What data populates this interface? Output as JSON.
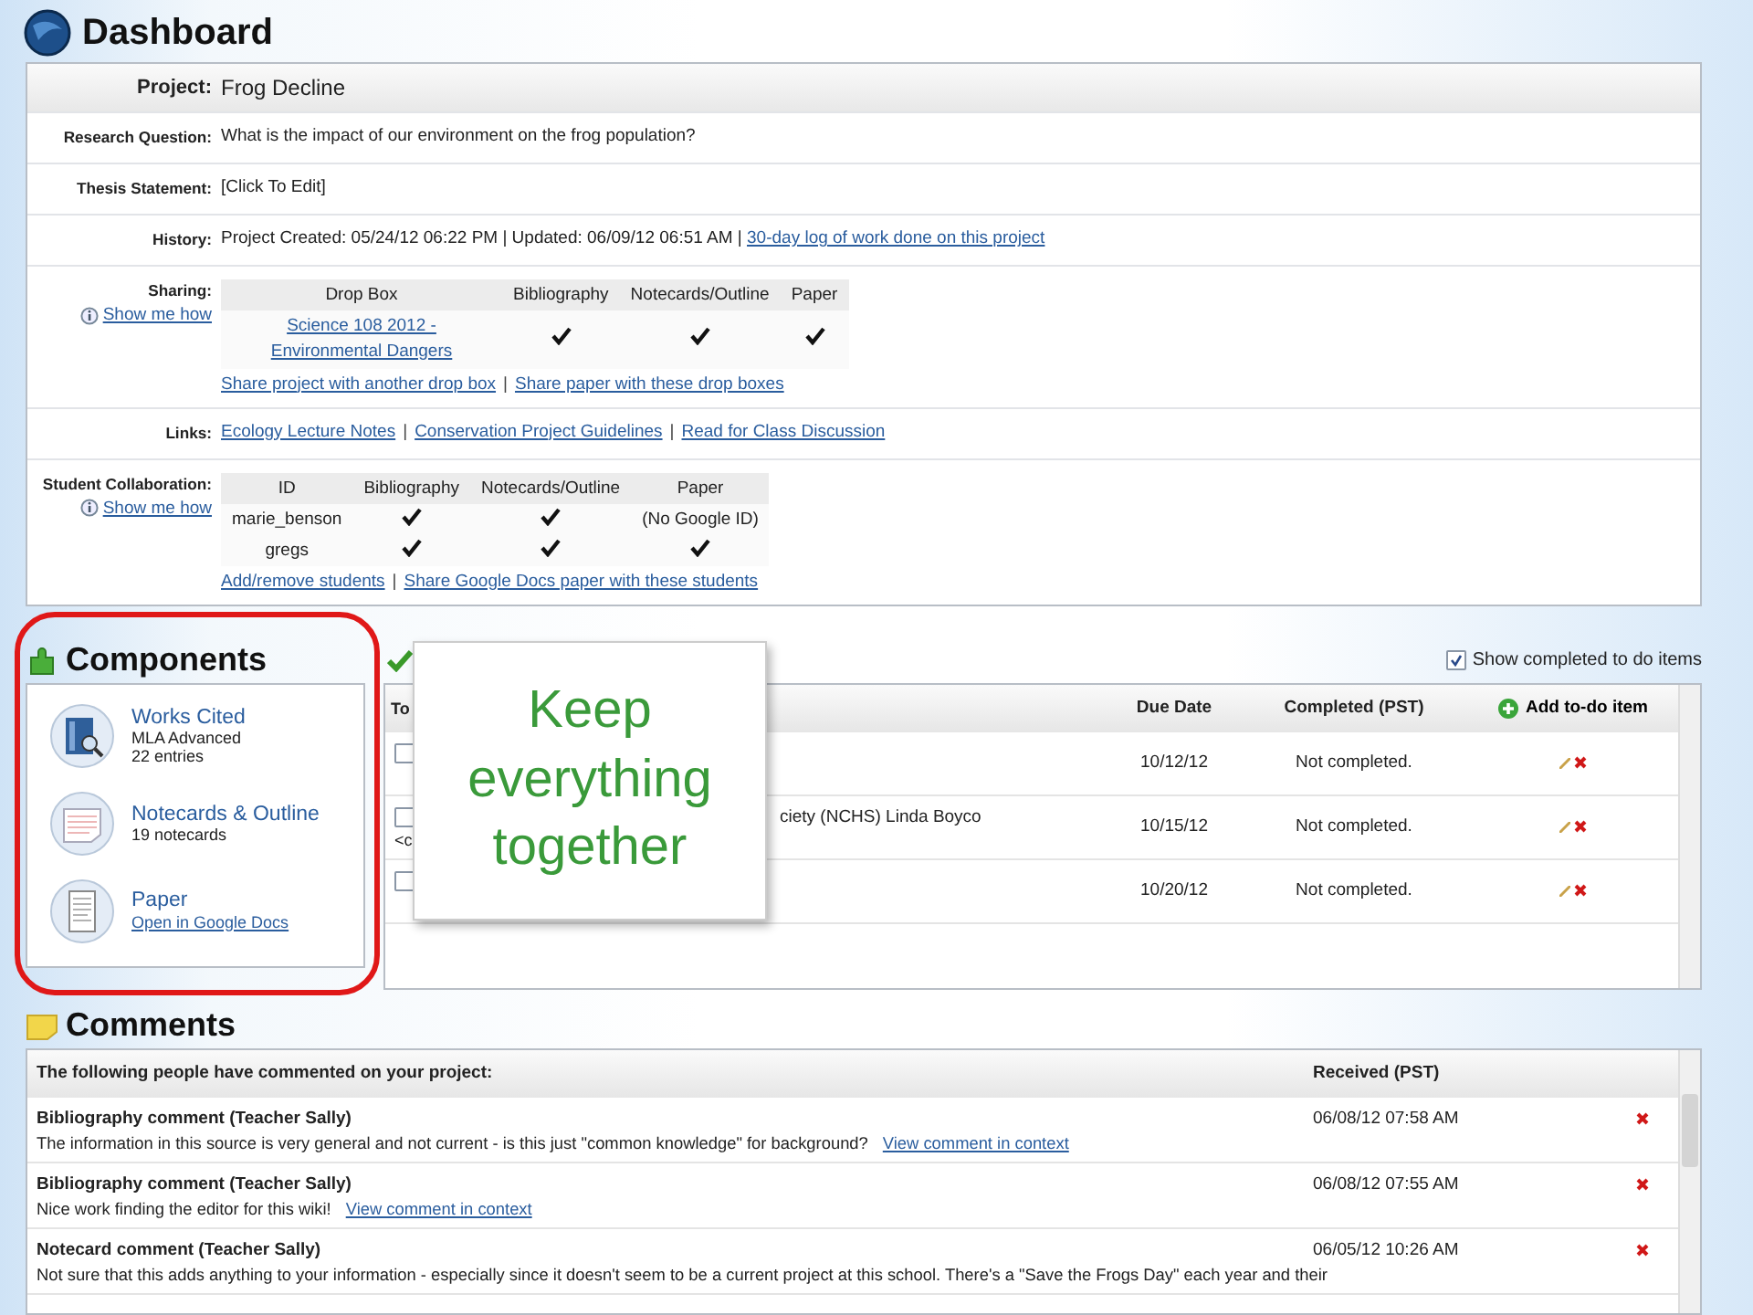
{
  "header": {
    "title": "Dashboard"
  },
  "project": {
    "rows": [
      {
        "kind": "title",
        "label": "Project:",
        "value": "Frog Decline"
      },
      {
        "kind": "text",
        "label": "Research Question:",
        "value": "What is the impact of our environment on the frog population?"
      },
      {
        "kind": "text",
        "label": "Thesis Statement:",
        "value": "[Click To Edit]"
      },
      {
        "kind": "history",
        "label": "History:",
        "value": "Project Created: 05/24/12 06:22 PM | Updated: 06/09/12 06:51 AM |",
        "link": "30-day log of work done on this project"
      },
      {
        "kind": "table",
        "label": "Sharing:",
        "help": "Show me how",
        "columns": [
          "Drop Box",
          "Bibliography",
          "Notecards/Outline",
          "Paper"
        ],
        "rows": [
          {
            "cells": [
              {
                "kind": "link",
                "text": "Science 108 2012 - Environmental Dangers"
              },
              {
                "kind": "check",
                "checked": true
              },
              {
                "kind": "check",
                "checked": true
              },
              {
                "kind": "check",
                "checked": true
              }
            ]
          }
        ],
        "separator": "|",
        "links": [
          "Share project with another drop box",
          "Share paper with these drop boxes"
        ]
      },
      {
        "kind": "links",
        "label": "Links:",
        "separator": "|",
        "links": [
          "Ecology Lecture Notes",
          "Conservation Project Guidelines",
          "Read for Class Discussion"
        ]
      },
      {
        "kind": "table",
        "label": "Student Collaboration:",
        "help": "Show me how",
        "columns": [
          "ID",
          "Bibliography",
          "Notecards/Outline",
          "Paper"
        ],
        "rows": [
          {
            "cells": [
              {
                "kind": "text",
                "text": "marie_benson"
              },
              {
                "kind": "check",
                "checked": true
              },
              {
                "kind": "check",
                "checked": true
              },
              {
                "kind": "text",
                "text": "(No Google ID)"
              }
            ]
          },
          {
            "cells": [
              {
                "kind": "text",
                "text": "gregs"
              },
              {
                "kind": "check",
                "checked": true
              },
              {
                "kind": "check",
                "checked": true
              },
              {
                "kind": "check",
                "checked": true
              }
            ]
          }
        ],
        "separator": "|",
        "links": [
          "Add/remove students",
          "Share Google Docs paper with these students"
        ]
      }
    ]
  },
  "components": {
    "title": "Components",
    "items": [
      {
        "kind": "book",
        "title": "Works Cited",
        "details": [
          "MLA Advanced",
          "22 entries"
        ]
      },
      {
        "kind": "notecards",
        "title": "Notecards & Outline",
        "details": [
          "19 notecards"
        ]
      },
      {
        "kind": "paper",
        "title": "Paper",
        "link": "Open in Google Docs"
      }
    ]
  },
  "todo": {
    "show_completed": {
      "label": "Show completed to do items",
      "checked": true
    },
    "columns": [
      "To",
      "Due Date",
      "Completed (PST)"
    ],
    "add_button": "Add to-do item",
    "rows": [
      {
        "checked": false,
        "task": [],
        "due": "10/12/12",
        "completed": "Not completed."
      },
      {
        "checked": false,
        "task": [
          "ciety (NCHS) Linda Boyco",
          "<c"
        ],
        "due": "10/15/12",
        "completed": "Not completed."
      },
      {
        "checked": false,
        "task": [],
        "due": "10/20/12",
        "completed": "Not completed."
      }
    ]
  },
  "callout": {
    "text": "Keep everything together"
  },
  "comments": {
    "title": "Comments",
    "header": "The following people have commented on your project:",
    "received_header": "Received (PST)",
    "items": [
      {
        "title": "Bibliography comment (Teacher Sally)",
        "text": "The information in this source is very general and not current - is this just \"common knowledge\" for background?",
        "link": "View comment in context",
        "received": "06/08/12 07:58 AM"
      },
      {
        "title": "Bibliography comment (Teacher Sally)",
        "text": "Nice work finding the editor for this wiki!",
        "link": "View comment in context",
        "received": "06/08/12 07:55 AM"
      },
      {
        "title": "Notecard comment (Teacher Sally)",
        "text": "Not sure that this adds anything to your information - especially since it doesn't seem to be a current project at this school. There's a \"Save the Frogs Day\" each year and their",
        "received": "06/05/12 10:26 AM"
      }
    ]
  }
}
